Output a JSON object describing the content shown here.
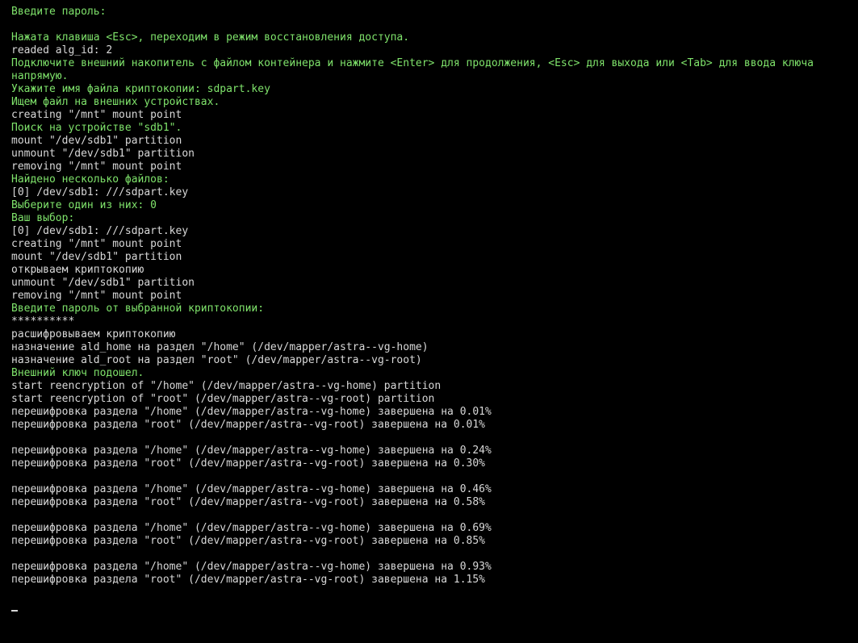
{
  "terminal": {
    "lines": [
      {
        "text": "Введите пароль:",
        "color": "green"
      },
      {
        "text": "",
        "color": "white"
      },
      {
        "text": "Нажата клавиша <Esc>, переходим в режим восстановления доступа.",
        "color": "green"
      },
      {
        "text": "readed alg_id: 2",
        "color": "white"
      },
      {
        "text": "Подключите внешний накопитель с файлом контейнера и нажмите <Enter> для продолжения, <Esc> для выхода или <Tab> для ввода ключа",
        "color": "green"
      },
      {
        "text": "напрямую.",
        "color": "green"
      },
      {
        "text": "Укажите имя файла криптокопии: sdpart.key",
        "color": "green"
      },
      {
        "text": "Ищем файл на внешних устройствах.",
        "color": "green"
      },
      {
        "text": "creating \"/mnt\" mount point",
        "color": "white"
      },
      {
        "text": "Поиск на устройстве \"sdb1\".",
        "color": "green"
      },
      {
        "text": "mount \"/dev/sdb1\" partition",
        "color": "white"
      },
      {
        "text": "unmount \"/dev/sdb1\" partition",
        "color": "white"
      },
      {
        "text": "removing \"/mnt\" mount point",
        "color": "white"
      },
      {
        "text": "Найдено несколько файлов:",
        "color": "green"
      },
      {
        "text": "[0] /dev/sdb1: ///sdpart.key",
        "color": "white"
      },
      {
        "text": "Выберите один из них: 0",
        "color": "green"
      },
      {
        "text": "Ваш выбор:",
        "color": "green"
      },
      {
        "text": "[0] /dev/sdb1: ///sdpart.key",
        "color": "white"
      },
      {
        "text": "creating \"/mnt\" mount point",
        "color": "white"
      },
      {
        "text": "mount \"/dev/sdb1\" partition",
        "color": "white"
      },
      {
        "text": "открываем криптокопию",
        "color": "white"
      },
      {
        "text": "unmount \"/dev/sdb1\" partition",
        "color": "white"
      },
      {
        "text": "removing \"/mnt\" mount point",
        "color": "white"
      },
      {
        "text": "Введите пароль от выбранной криптокопии:",
        "color": "green"
      },
      {
        "text": "**********",
        "color": "white"
      },
      {
        "text": "расшифровываем криптокопию",
        "color": "white"
      },
      {
        "text": "назначение ald_home на раздел \"/home\" (/dev/mapper/astra--vg-home)",
        "color": "white"
      },
      {
        "text": "назначение ald_root на раздел \"root\" (/dev/mapper/astra--vg-root)",
        "color": "white"
      },
      {
        "text": "Внешний ключ подошел.",
        "color": "green"
      },
      {
        "text": "start reencryption of \"/home\" (/dev/mapper/astra--vg-home) partition",
        "color": "white"
      },
      {
        "text": "start reencryption of \"root\" (/dev/mapper/astra--vg-root) partition",
        "color": "white"
      },
      {
        "text": "перешифровка раздела \"/home\" (/dev/mapper/astra--vg-home) завершена на 0.01%",
        "color": "white"
      },
      {
        "text": "перешифровка раздела \"root\" (/dev/mapper/astra--vg-root) завершена на 0.01%",
        "color": "white"
      },
      {
        "text": "",
        "color": "white"
      },
      {
        "text": "перешифровка раздела \"/home\" (/dev/mapper/astra--vg-home) завершена на 0.24%",
        "color": "white"
      },
      {
        "text": "перешифровка раздела \"root\" (/dev/mapper/astra--vg-root) завершена на 0.30%",
        "color": "white"
      },
      {
        "text": "",
        "color": "white"
      },
      {
        "text": "перешифровка раздела \"/home\" (/dev/mapper/astra--vg-home) завершена на 0.46%",
        "color": "white"
      },
      {
        "text": "перешифровка раздела \"root\" (/dev/mapper/astra--vg-root) завершена на 0.58%",
        "color": "white"
      },
      {
        "text": "",
        "color": "white"
      },
      {
        "text": "перешифровка раздела \"/home\" (/dev/mapper/astra--vg-home) завершена на 0.69%",
        "color": "white"
      },
      {
        "text": "перешифровка раздела \"root\" (/dev/mapper/astra--vg-root) завершена на 0.85%",
        "color": "white"
      },
      {
        "text": "",
        "color": "white"
      },
      {
        "text": "перешифровка раздела \"/home\" (/dev/mapper/astra--vg-home) завершена на 0.93%",
        "color": "white"
      },
      {
        "text": "перешифровка раздела \"root\" (/dev/mapper/astra--vg-root) завершена на 1.15%",
        "color": "white"
      }
    ]
  },
  "colors": {
    "background": "#000000",
    "green_text": "#7fe36b",
    "white_text": "#d8d8d8"
  }
}
